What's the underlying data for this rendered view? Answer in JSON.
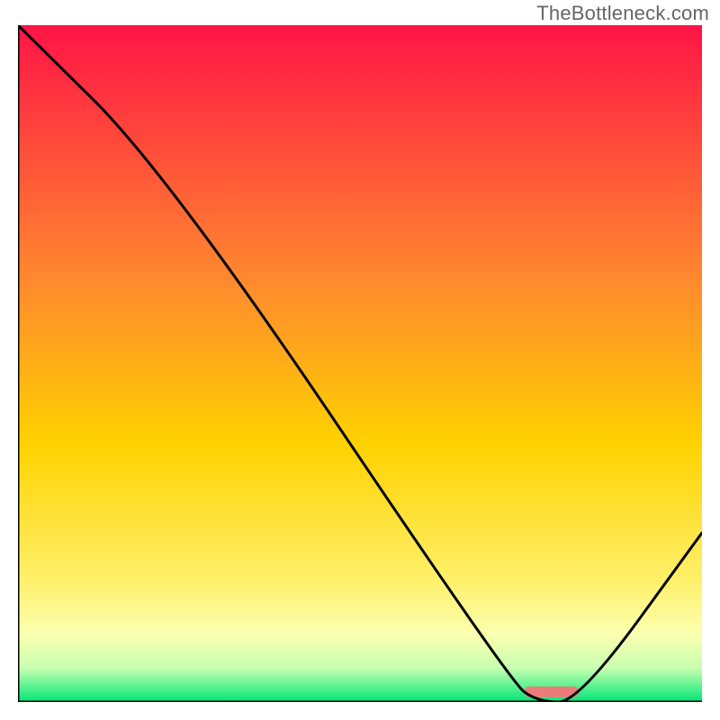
{
  "watermark": "TheBottleneck.com",
  "chart_data": {
    "type": "line",
    "title": "",
    "xlabel": "",
    "ylabel": "",
    "xlim": [
      0,
      100
    ],
    "ylim": [
      0,
      100
    ],
    "x": [
      0,
      22,
      72,
      76,
      82,
      100
    ],
    "values": [
      100,
      78,
      3,
      0,
      0,
      25
    ],
    "marker": {
      "x_start": 74,
      "x_end": 82,
      "y": 1.5,
      "color": "#ee7b7b"
    },
    "gradient_stops": [
      {
        "offset": 0,
        "color": "#ff1446"
      },
      {
        "offset": 38,
        "color": "#ff8a2e"
      },
      {
        "offset": 62,
        "color": "#ffd200"
      },
      {
        "offset": 82,
        "color": "#fff06a"
      },
      {
        "offset": 90,
        "color": "#fbffb0"
      },
      {
        "offset": 95,
        "color": "#c7ffb0"
      },
      {
        "offset": 100,
        "color": "#00e676"
      }
    ],
    "line_color": "#000000",
    "axis_color": "#000000"
  }
}
